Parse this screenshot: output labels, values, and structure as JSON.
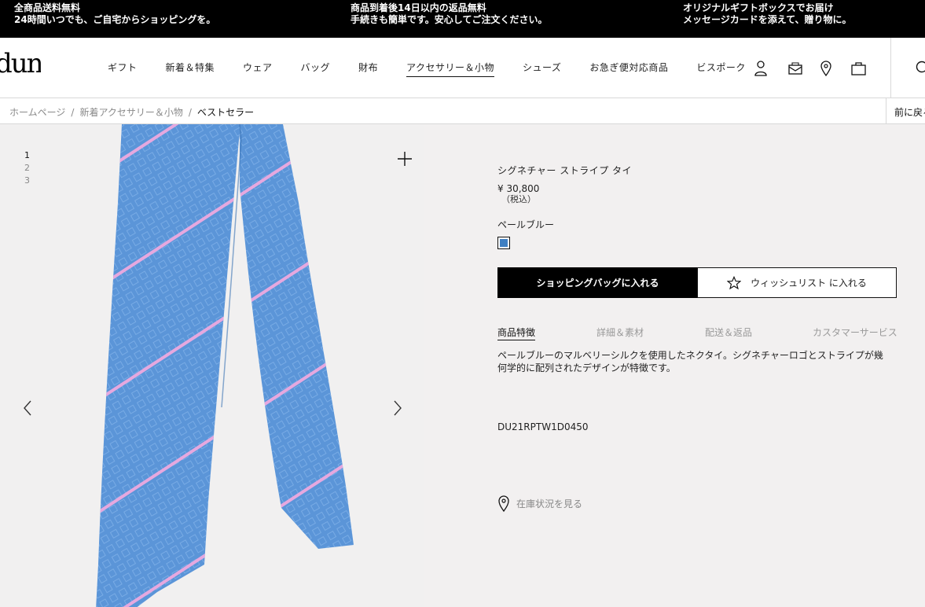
{
  "promo": [
    {
      "line1": "全商品送料無料",
      "line2": "24時間いつでも、ご自宅からショッピングを。"
    },
    {
      "line1": "商品到着後14日以内の返品無料",
      "line2": "手続きも簡単です。安心してご注文ください。"
    },
    {
      "line1": "オリジナルギフトボックスでお届け",
      "line2": "メッセージカードを添えて、贈り物に。"
    }
  ],
  "header": {
    "logo": "dunhill",
    "nav": [
      "ギフト",
      "新着＆特集",
      "ウェア",
      "バッグ",
      "財布",
      "アクセサリー＆小物",
      "シューズ",
      "お急ぎ便対応商品",
      "ビスポーク"
    ],
    "active_nav_index": 5,
    "icons": [
      "account-icon",
      "mail-icon",
      "store-locator-icon",
      "shopping-bag-icon",
      "search-icon"
    ]
  },
  "breadcrumb": {
    "items": [
      "ホームページ",
      "新着アクセサリー＆小物",
      "ベストセラー"
    ],
    "separator": "/",
    "back": "前に戻る"
  },
  "gallery": {
    "pager": [
      "1",
      "2",
      "3"
    ],
    "current_page": 1,
    "tie_color": "#5b95d8",
    "stripe_color": "#e6a8df"
  },
  "product": {
    "name": "シグネチャー ストライプ タイ",
    "price": "¥ 30,800",
    "tax_note": "（税込）",
    "color_name": "ペールブルー",
    "swatch_color": "#3f7fc2",
    "add_to_bag": "ショッピングバッグに入れる",
    "wishlist": "ウィッシュリスト に入れる",
    "tabs": [
      "商品特徴",
      "詳細＆素材",
      "配送＆返品",
      "カスタマーサービス"
    ],
    "active_tab_index": 0,
    "description": "ペールブルーのマルベリーシルクを使用したネクタイ。シグネチャーロゴとストライプが幾何学的に配列されたデザインが特徴です。",
    "sku": "DU21RPTW1D0450",
    "stock_link": "在庫状況を見る"
  }
}
